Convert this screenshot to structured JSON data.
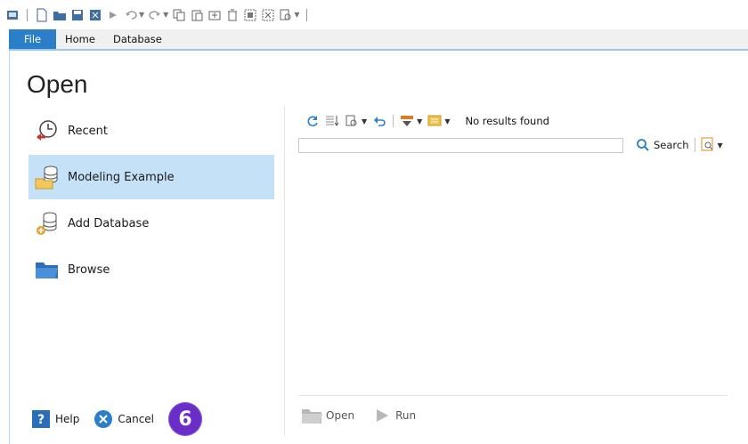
{
  "ribbon": {
    "tabs": [
      "File",
      "Home",
      "Database"
    ]
  },
  "backstage": {
    "title": "Open",
    "nav": [
      {
        "label": "Recent",
        "icon": "recent-clock-icon"
      },
      {
        "label": "Modeling Example",
        "icon": "database-folder-icon",
        "selected": true
      },
      {
        "label": "Add Database",
        "icon": "add-database-icon"
      },
      {
        "label": "Browse",
        "icon": "folder-icon"
      }
    ],
    "toolbar": {
      "status": "No results found"
    },
    "search": {
      "value": "",
      "button_label": "Search"
    },
    "actions": {
      "open_label": "Open",
      "run_label": "Run"
    },
    "footer": {
      "help_label": "Help",
      "cancel_label": "Cancel",
      "step_badge": "6"
    }
  },
  "colors": {
    "accent": "#2a7fc8",
    "selected_bg": "#c5e1f7",
    "badge": "#6a2dc8"
  }
}
